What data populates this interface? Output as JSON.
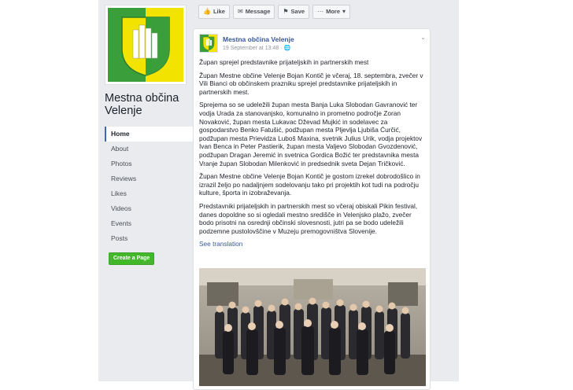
{
  "page": {
    "name": "Mestna občina Velenje",
    "colors": {
      "brand_green": "#3a9e3a",
      "brand_yellow": "#f2e300",
      "link": "#365899",
      "create_button": "#42b72a"
    }
  },
  "sidebar": {
    "items": [
      {
        "label": "Home",
        "active": true
      },
      {
        "label": "About"
      },
      {
        "label": "Photos"
      },
      {
        "label": "Reviews"
      },
      {
        "label": "Likes"
      },
      {
        "label": "Videos"
      },
      {
        "label": "Events"
      },
      {
        "label": "Posts"
      }
    ],
    "create_page_label": "Create a Page"
  },
  "actions": {
    "like": {
      "label": "Like",
      "icon": "thumbs-up-icon"
    },
    "message": {
      "label": "Message",
      "icon": "message-icon"
    },
    "save": {
      "label": "Save",
      "icon": "bookmark-icon"
    },
    "more": {
      "label": "More",
      "icon": "ellipsis-icon"
    }
  },
  "post": {
    "author": "Mestna občina Velenje",
    "timestamp": "19 September at 13:48 · ",
    "paragraphs": [
      "Župan sprejel predstavnike prijateljskih in partnerskih mest",
      "Župan Mestne občine Velenje Bojan Kontič je včeraj, 18. septembra, zvečer v Vili Bianci ob občinskem prazniku sprejel predstavnike prijateljskih in partnerskih mest.",
      "Sprejema so se udeležili župan mesta Banja Luka Slobodan Gavranović ter vodja Urada za stanovanjsko, komunalno in prometno področje Zoran Novaković, župan mesta Lukavac Dževad Mujkić in sodelavec za gospodarstvo Benko Fatušić, podžupan mesta Pljevlja Ljubiša Ćurčić, podžupan mesta Prievidza Luboš Maxina, svetnik Julius Urik, vodja projektov Ivan Benca in Peter Pastierik, župan mesta Valjevo Slobodan Gvozdenović, podžupan Dragan Jeremić in svetnica Gordica Božić ter predstavnika mesta Vranje župan Slobodan Milenković in predsednik sveta Dejan Tričković.",
      "Župan Mestne občine Velenje Bojan Kontič je gostom izrekel dobrodošlico in izrazil željo po nadaljnjem sodelovanju tako pri projektih kot tudi na področju kulture, športa in izobraževanja.",
      "Predstavniki prijateljskih in partnerskih mest so včeraj obiskali Pikin festival, danes dopoldne so si ogledali mestno središče in Velenjsko plažo, zvečer bodo prisotni na osrednji občinski slovesnosti, jutri pa se bodo udeležili podzemne pustolovščine v Muzeju premogovništva Slovenije."
    ],
    "see_translation": "See translation"
  }
}
